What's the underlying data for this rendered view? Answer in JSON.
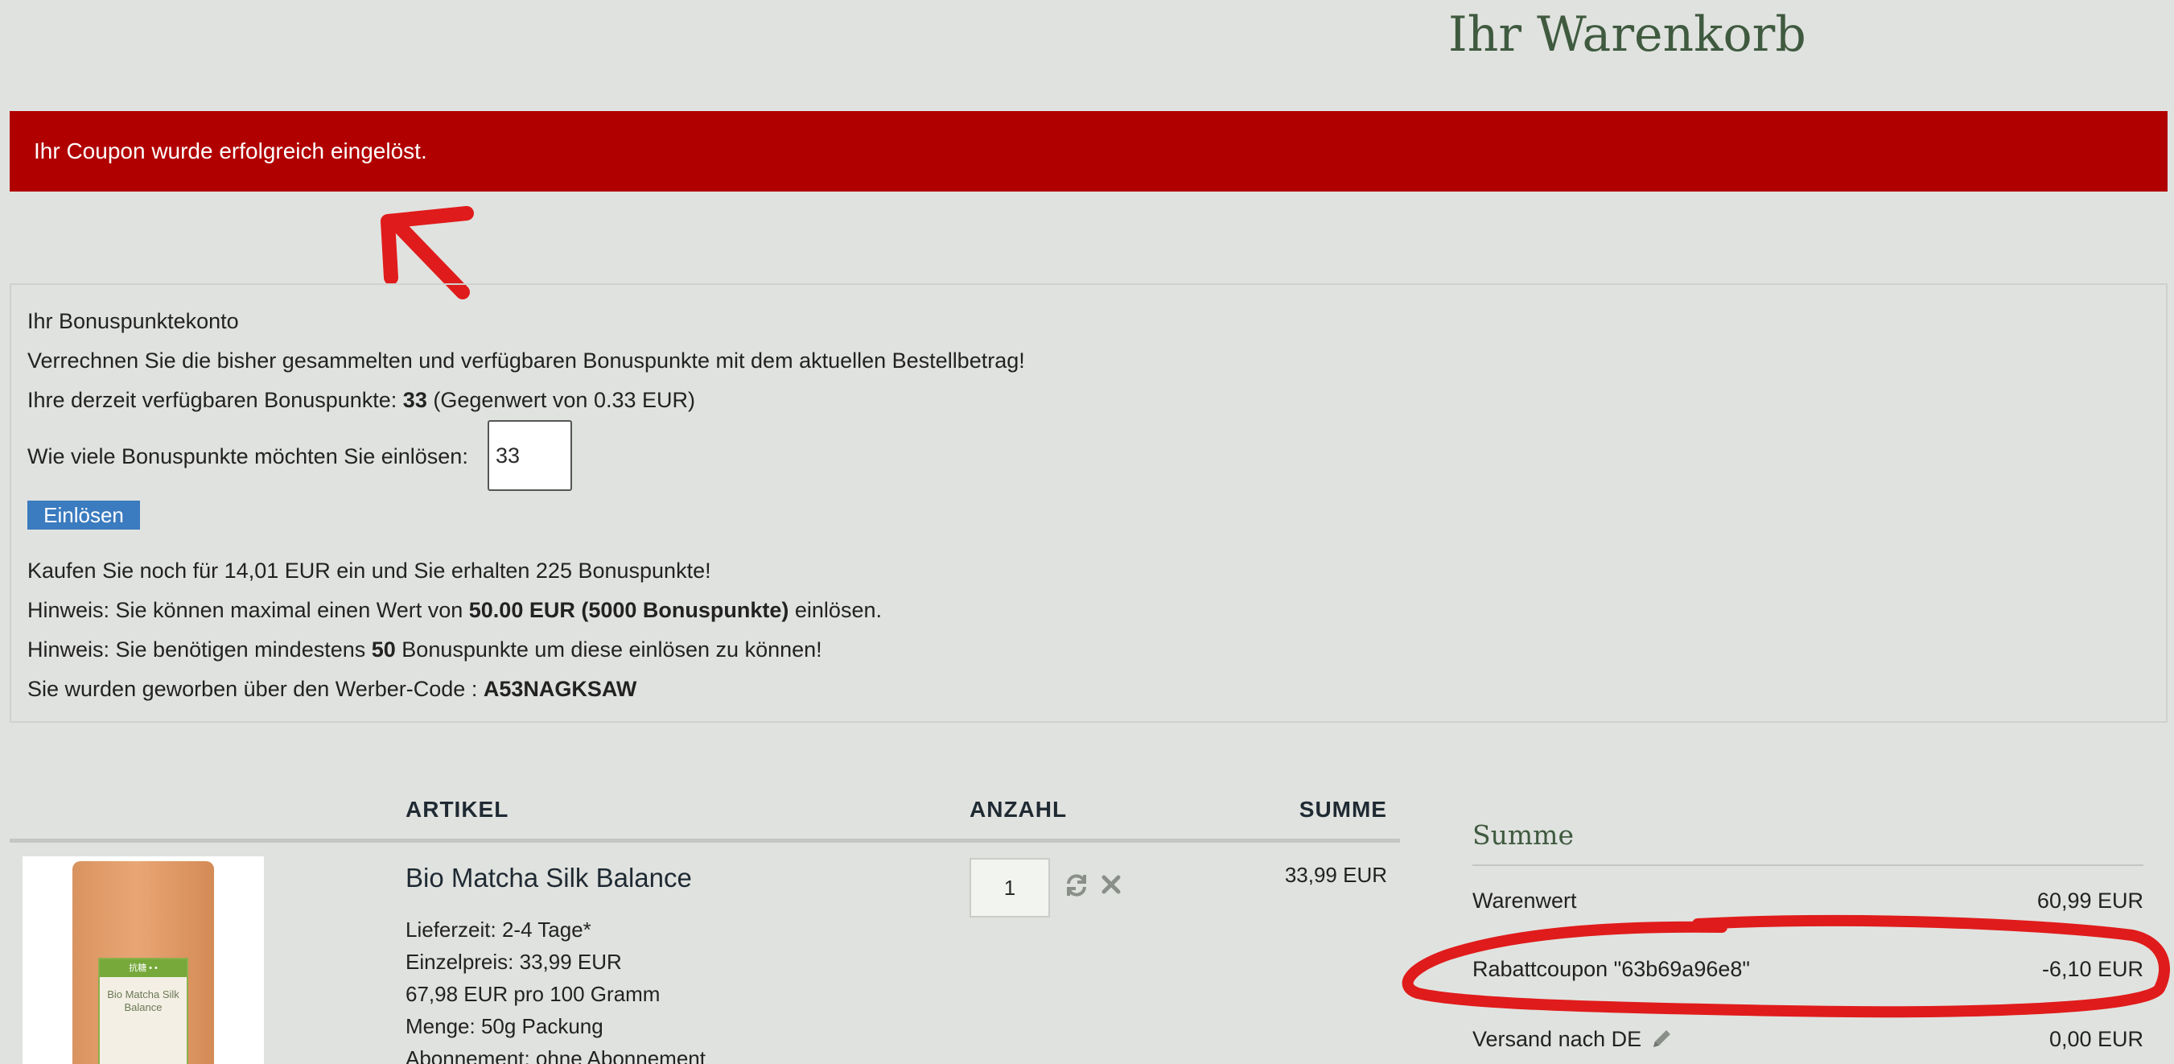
{
  "header": {
    "title": "Ihr Warenkorb"
  },
  "alert": {
    "message": "Ihr Coupon wurde erfolgreich eingelöst."
  },
  "bonus": {
    "heading": "Ihr Bonuspunktekonto",
    "description": "Verrechnen Sie die bisher gesammelten und verfügbaren Bonuspunkte mit dem aktuellen Bestellbetrag!",
    "available_prefix": "Ihre derzeit verfügbaren Bonuspunkte: ",
    "available_points": "33",
    "available_suffix": " (Gegenwert von 0.33 EUR)",
    "redeem_question": "Wie viele Bonuspunkte möchten Sie einlösen:",
    "input_value": "33",
    "redeem_button": "Einlösen",
    "buy_more": "Kaufen Sie noch für 14,01 EUR ein und Sie erhalten 225 Bonuspunkte!",
    "max_prefix": "Hinweis: Sie können maximal einen Wert von ",
    "max_value": "50.00 EUR (5000 Bonuspunkte)",
    "max_suffix": " einlösen.",
    "min_prefix": "Hinweis: Sie benötigen mindestens ",
    "min_value": "50",
    "min_suffix": " Bonuspunkte um diese einlösen zu können!",
    "referral_prefix": "Sie wurden geworben über den Werber-Code : ",
    "referral_code": "A53NAGKSAW"
  },
  "table": {
    "headers": {
      "article": "ARTIKEL",
      "quantity": "ANZAHL",
      "sum": "SUMME"
    }
  },
  "item": {
    "name": "Bio Matcha Silk Balance",
    "delivery": "Lieferzeit: 2-4 Tage*",
    "unit_price": "Einzelpreis: 33,99 EUR",
    "base_price": "67,98 EUR pro 100 Gramm",
    "amount": "Menge: 50g Packung",
    "subscription": "Abonnement: ohne Abonnement",
    "quantity": "1",
    "total": "33,99 EUR",
    "image_label": "Bio Matcha Silk Balance"
  },
  "summary": {
    "title": "Summe",
    "rows": [
      {
        "label": "Warenwert",
        "value": "60,99 EUR"
      },
      {
        "label": "Rabattcoupon \"63b69a96e8\"",
        "value": "-6,10 EUR"
      },
      {
        "label": "Versand nach DE",
        "value": "0,00 EUR"
      }
    ]
  },
  "colors": {
    "alert_bg": "#b10000",
    "title_green": "#3f5a3f",
    "button_blue": "#3b7bbf",
    "annotation_red": "#e01b1b"
  },
  "icons": [
    "refresh-icon",
    "close-icon",
    "pencil-icon"
  ]
}
